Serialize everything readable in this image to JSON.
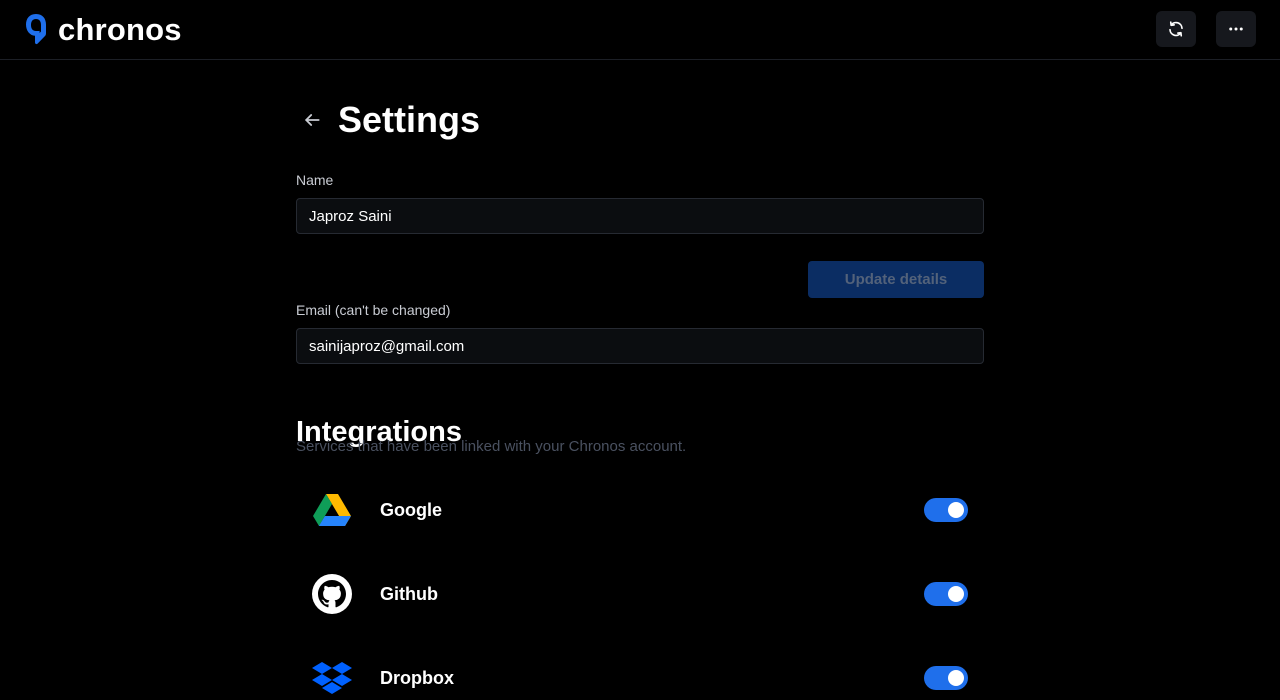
{
  "app": {
    "name": "chronos",
    "brand_color": "#1f6feb",
    "header_buttons": [
      {
        "name": "refresh",
        "icon": "refresh-icon"
      },
      {
        "name": "more",
        "icon": "more-horizontal-icon"
      }
    ]
  },
  "page": {
    "title": "Settings",
    "back_icon": "arrow-left-icon"
  },
  "form": {
    "name_label": "Name",
    "name_value": "Japroz Saini",
    "update_label": "Update details",
    "update_enabled": false,
    "email_label": "Email (can't be changed)",
    "email_value": "sainijaproz@gmail.com",
    "email_editable": false
  },
  "integrations": {
    "title": "Integrations",
    "subtitle": "Services that have been linked with your Chronos account.",
    "items": [
      {
        "name": "Google",
        "icon": "google-drive-icon",
        "enabled": true
      },
      {
        "name": "Github",
        "icon": "github-icon",
        "enabled": true
      },
      {
        "name": "Dropbox",
        "icon": "dropbox-icon",
        "enabled": true
      }
    ],
    "toggle_on_color": "#1f6feb"
  }
}
